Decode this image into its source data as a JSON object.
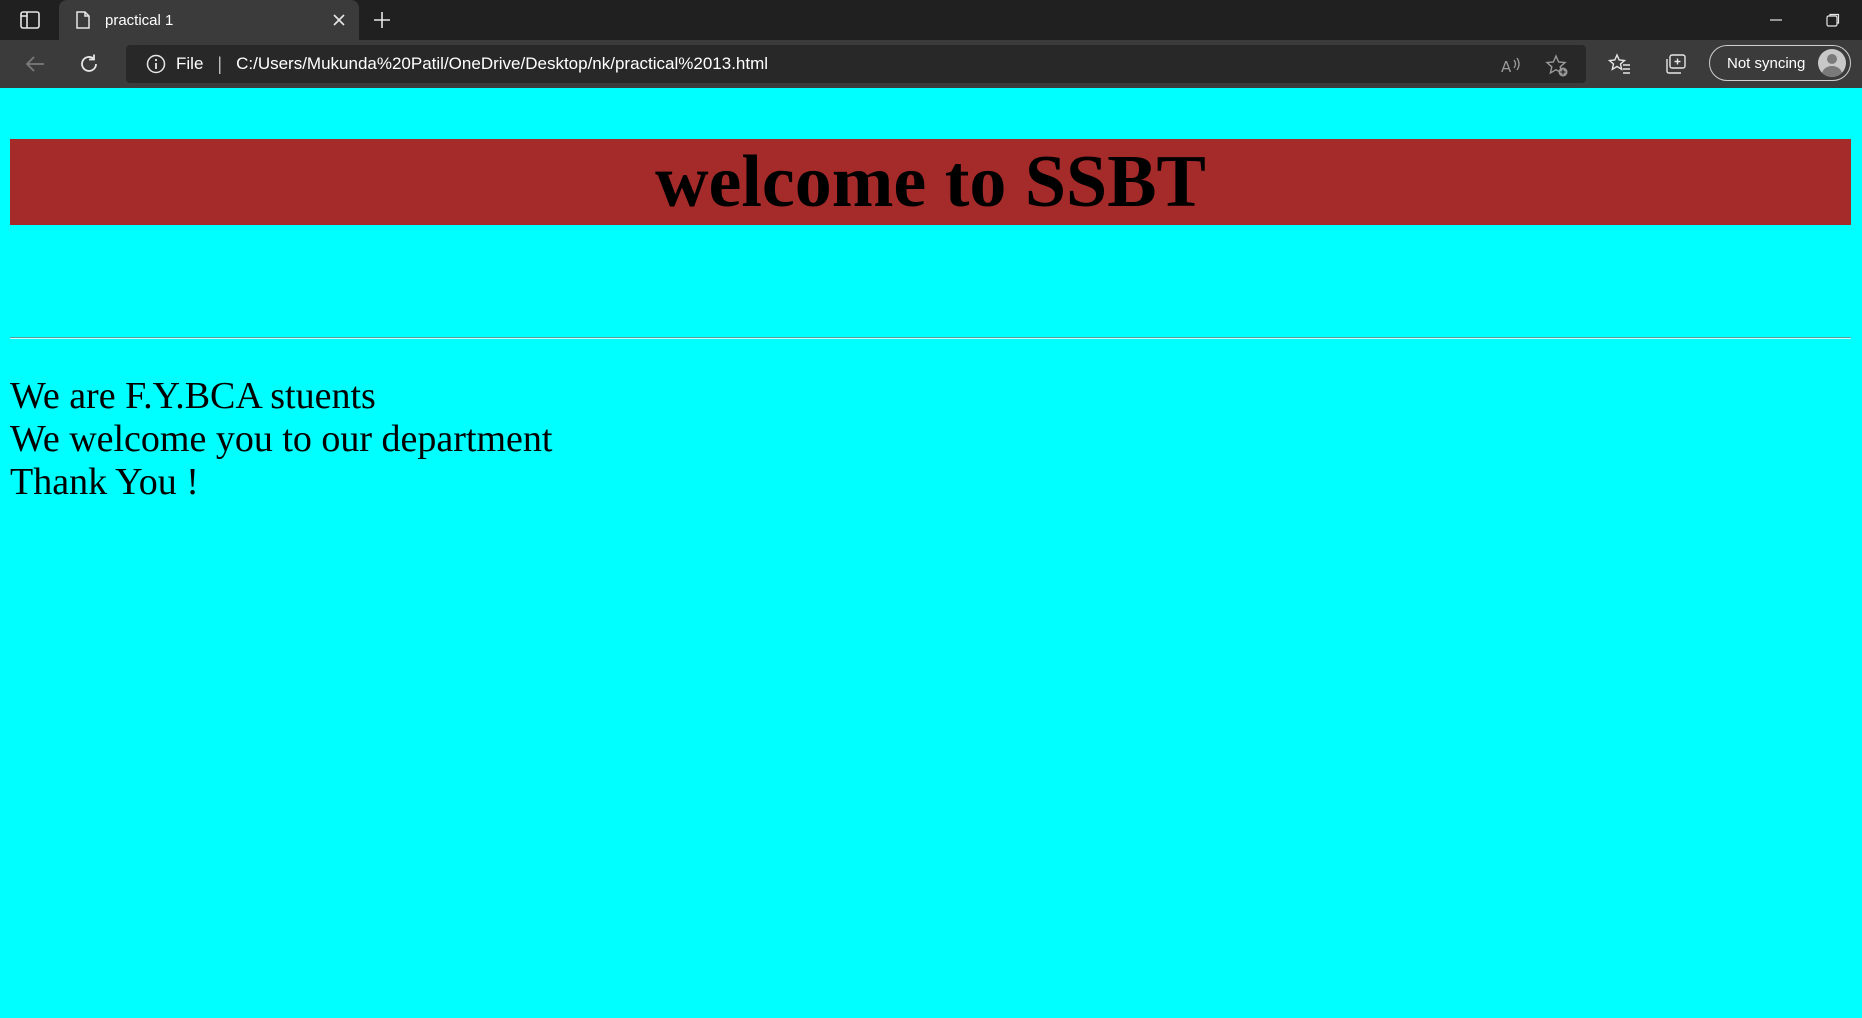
{
  "browser": {
    "tab": {
      "title": "practical 1"
    },
    "address": {
      "scheme_label": "File",
      "separator": "|",
      "url": "C:/Users/Mukunda%20Patil/OneDrive/Desktop/nk/practical%2013.html"
    },
    "profile": {
      "label": "Not syncing"
    },
    "icons": {
      "tab_actions": "tab-actions-icon",
      "document": "document-icon",
      "close": "close-icon",
      "new_tab": "plus-icon",
      "minimize": "minimize-icon",
      "restore": "restore-icon",
      "back": "back-arrow-icon",
      "refresh": "refresh-icon",
      "info": "info-icon",
      "read_aloud": "read-aloud-icon",
      "add_favorite": "add-favorite-icon",
      "favorites": "favorites-icon",
      "collections": "collections-icon"
    }
  },
  "page": {
    "background_color": "#00ffff",
    "banner": {
      "heading": "welcome to SSBT",
      "background_color": "#a52a2a"
    },
    "lines": [
      "We are F.Y.BCA stuents",
      "We welcome you to our department",
      "Thank You !"
    ]
  }
}
